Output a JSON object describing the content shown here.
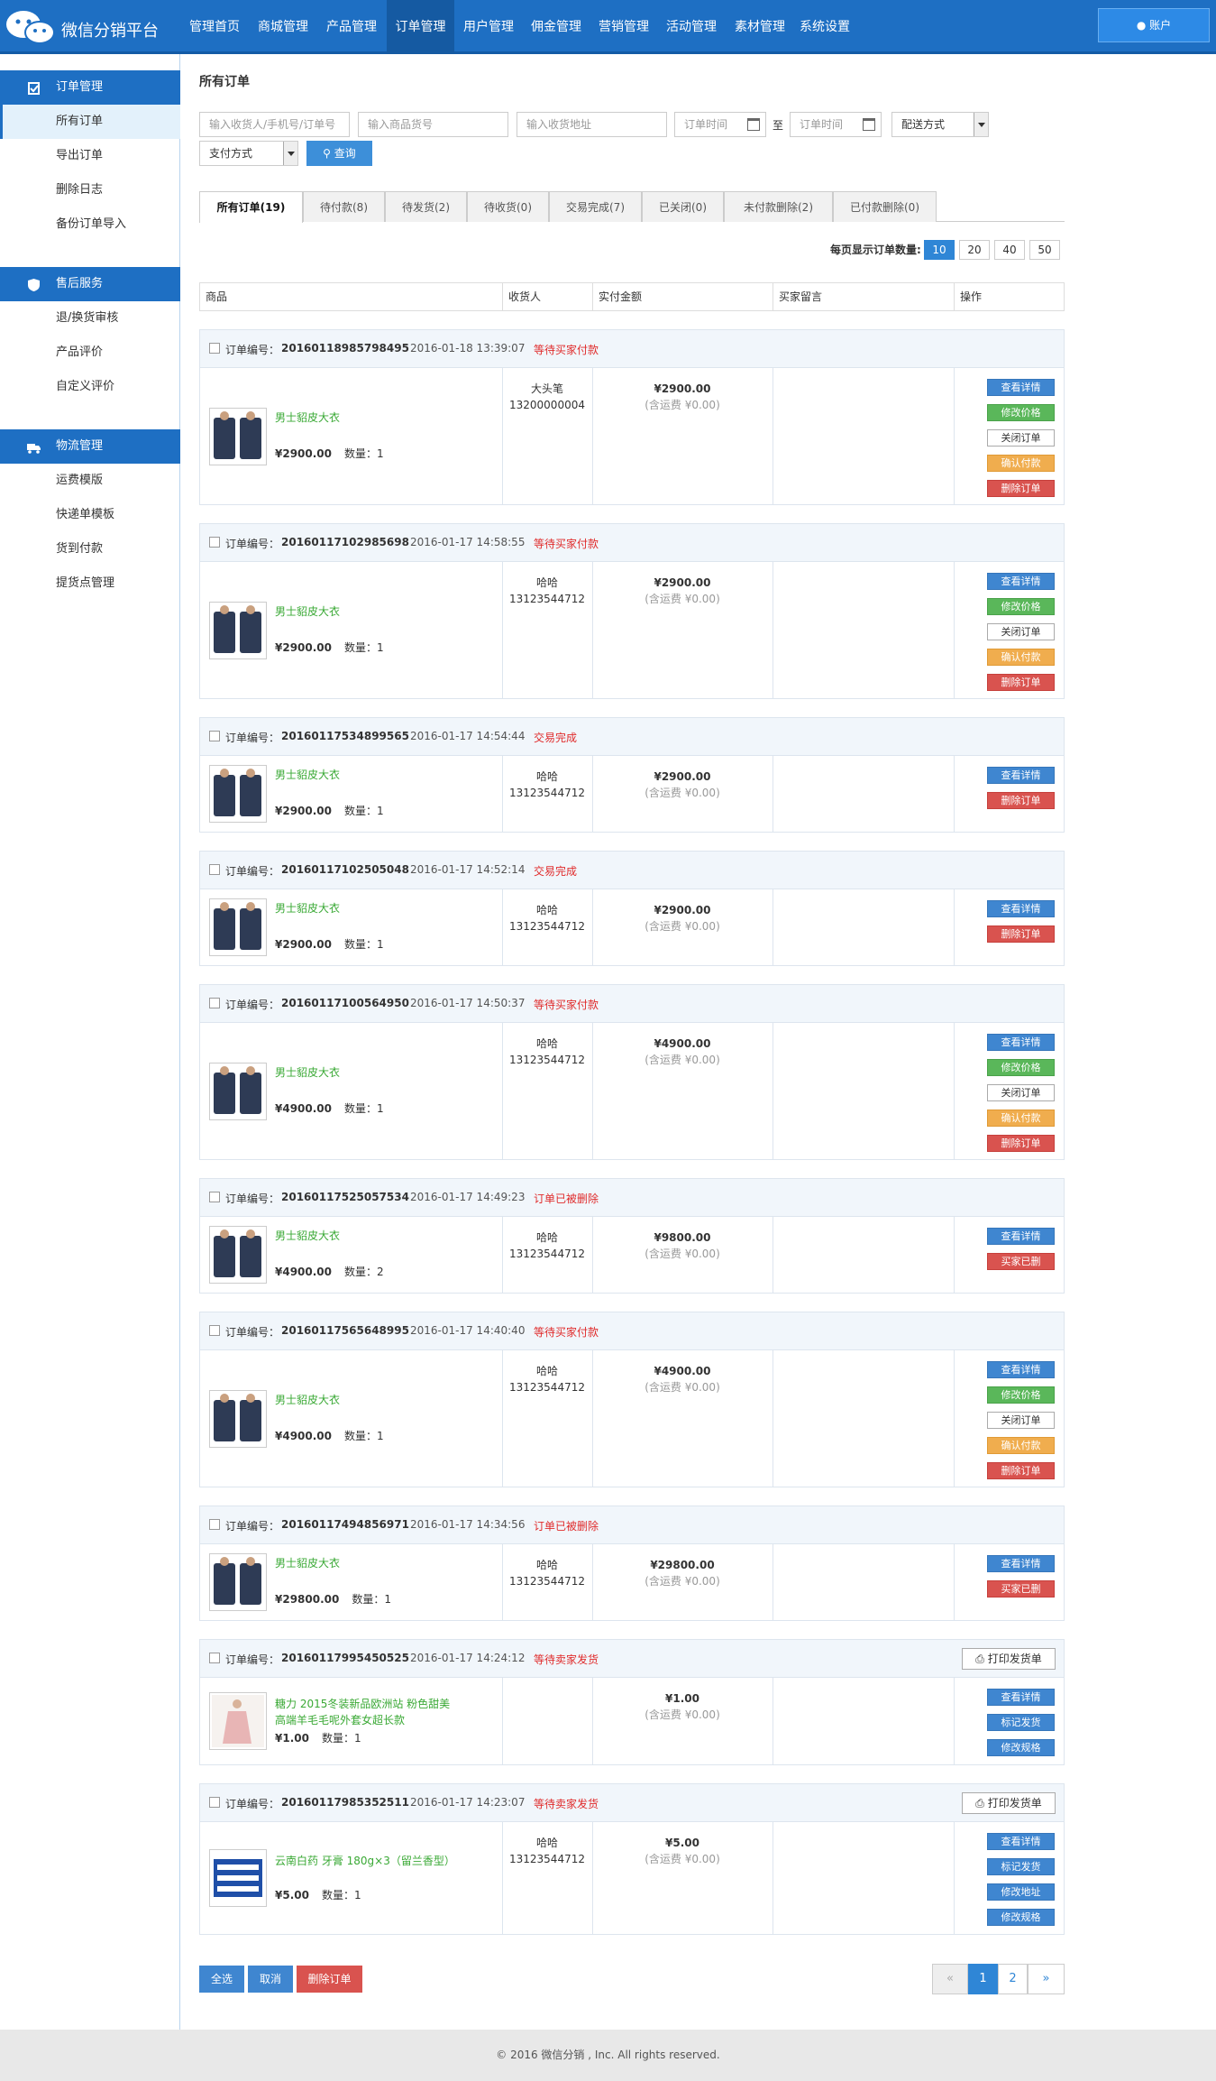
{
  "app": {
    "title": "微信分销平台",
    "account_label": "账户"
  },
  "nav": [
    {
      "label": "管理首页"
    },
    {
      "label": "商城管理"
    },
    {
      "label": "产品管理"
    },
    {
      "label": "订单管理",
      "active": true
    },
    {
      "label": "用户管理"
    },
    {
      "label": "佣金管理"
    },
    {
      "label": "营销管理"
    },
    {
      "label": "活动管理"
    },
    {
      "label": "素材管理"
    },
    {
      "label": "系统设置"
    }
  ],
  "sidebar": [
    {
      "title": "订单管理",
      "icon": "clipboard-icon",
      "items": [
        "所有订单",
        "导出订单",
        "删除日志",
        "备份订单导入"
      ]
    },
    {
      "title": "售后服务",
      "icon": "shield-icon",
      "items": [
        "退/换货审核",
        "产品评价",
        "自定义评价"
      ]
    },
    {
      "title": "物流管理",
      "icon": "truck-icon",
      "items": [
        "运费模版",
        "快递单模板",
        "货到付款",
        "提货点管理"
      ]
    }
  ],
  "page_title": "所有订单",
  "filters": {
    "receiver_placeholder": "输入收货人/手机号/订单号",
    "goods_placeholder": "输入商品货号",
    "address_placeholder": "输入收货地址",
    "time_from_placeholder": "订单时间",
    "to_label": "至",
    "time_to_placeholder": "订单时间",
    "shipping_select": "配送方式",
    "payment_select": "支付方式",
    "search_label": "查询"
  },
  "tabs": [
    "所有订单(19)",
    "待付款(8)",
    "待发货(2)",
    "待收货(0)",
    "交易完成(7)",
    "已关闭(0)",
    "未付款删除(2)",
    "已付款删除(0)"
  ],
  "per_page": {
    "label": "每页显示订单数量:",
    "options": [
      "10",
      "20",
      "40",
      "50"
    ],
    "selected": "10"
  },
  "columns": [
    "商品",
    "收货人",
    "实付金额",
    "买家留言",
    "操作"
  ],
  "order_label": "订单编号：",
  "orders": [
    {
      "no": "20160118985798495",
      "time": "2016-01-18 13:39:07",
      "status": "等待买家付款",
      "product": "男士貂皮大衣",
      "price": "¥2900.00",
      "qty": "数量：1",
      "receiver": "大头笔",
      "phone": "13200000004",
      "amount": "¥2900.00",
      "freight": "(含运费 ¥0.00)",
      "buttons": [
        {
          "label": "查看详情",
          "style": "blue"
        },
        {
          "label": "修改价格",
          "style": "green"
        },
        {
          "label": "关闭订单",
          "style": "white"
        },
        {
          "label": "确认付款",
          "style": "orange"
        },
        {
          "label": "删除订单",
          "style": "red"
        }
      ]
    },
    {
      "no": "20160117102985698",
      "time": "2016-01-17 14:58:55",
      "status": "等待买家付款",
      "product": "男士貂皮大衣",
      "price": "¥2900.00",
      "qty": "数量：1",
      "receiver": "哈哈",
      "phone": "13123544712",
      "amount": "¥2900.00",
      "freight": "(含运费 ¥0.00)",
      "buttons": [
        {
          "label": "查看详情",
          "style": "blue"
        },
        {
          "label": "修改价格",
          "style": "green"
        },
        {
          "label": "关闭订单",
          "style": "white"
        },
        {
          "label": "确认付款",
          "style": "orange"
        },
        {
          "label": "删除订单",
          "style": "red"
        }
      ]
    },
    {
      "no": "20160117534899565",
      "time": "2016-01-17 14:54:44",
      "status": "交易完成",
      "product": "男士貂皮大衣",
      "price": "¥2900.00",
      "qty": "数量：1",
      "receiver": "哈哈",
      "phone": "13123544712",
      "amount": "¥2900.00",
      "freight": "(含运费 ¥0.00)",
      "buttons": [
        {
          "label": "查看详情",
          "style": "blue"
        },
        {
          "label": "删除订单",
          "style": "red"
        }
      ]
    },
    {
      "no": "20160117102505048",
      "time": "2016-01-17 14:52:14",
      "status": "交易完成",
      "product": "男士貂皮大衣",
      "price": "¥2900.00",
      "qty": "数量：1",
      "receiver": "哈哈",
      "phone": "13123544712",
      "amount": "¥2900.00",
      "freight": "(含运费 ¥0.00)",
      "buttons": [
        {
          "label": "查看详情",
          "style": "blue"
        },
        {
          "label": "删除订单",
          "style": "red"
        }
      ]
    },
    {
      "no": "20160117100564950",
      "time": "2016-01-17 14:50:37",
      "status": "等待买家付款",
      "product": "男士貂皮大衣",
      "price": "¥4900.00",
      "qty": "数量：1",
      "receiver": "哈哈",
      "phone": "13123544712",
      "amount": "¥4900.00",
      "freight": "(含运费 ¥0.00)",
      "buttons": [
        {
          "label": "查看详情",
          "style": "blue"
        },
        {
          "label": "修改价格",
          "style": "green"
        },
        {
          "label": "关闭订单",
          "style": "white"
        },
        {
          "label": "确认付款",
          "style": "orange"
        },
        {
          "label": "删除订单",
          "style": "red"
        }
      ]
    },
    {
      "no": "20160117525057534",
      "time": "2016-01-17 14:49:23",
      "status": "订单已被删除",
      "product": "男士貂皮大衣",
      "price": "¥4900.00",
      "qty": "数量：2",
      "receiver": "哈哈",
      "phone": "13123544712",
      "amount": "¥9800.00",
      "freight": "(含运费 ¥0.00)",
      "buttons": [
        {
          "label": "查看详情",
          "style": "blue"
        },
        {
          "label": "买家已删",
          "style": "red"
        }
      ]
    },
    {
      "no": "20160117565648995",
      "time": "2016-01-17 14:40:40",
      "status": "等待买家付款",
      "product": "男士貂皮大衣",
      "price": "¥4900.00",
      "qty": "数量：1",
      "receiver": "哈哈",
      "phone": "13123544712",
      "amount": "¥4900.00",
      "freight": "(含运费 ¥0.00)",
      "buttons": [
        {
          "label": "查看详情",
          "style": "blue"
        },
        {
          "label": "修改价格",
          "style": "green"
        },
        {
          "label": "关闭订单",
          "style": "white"
        },
        {
          "label": "确认付款",
          "style": "orange"
        },
        {
          "label": "删除订单",
          "style": "red"
        }
      ]
    },
    {
      "no": "20160117494856971",
      "time": "2016-01-17 14:34:56",
      "status": "订单已被删除",
      "product": "男士貂皮大衣",
      "price": "¥29800.00",
      "qty": "数量：1",
      "receiver": "哈哈",
      "phone": "13123544712",
      "amount": "¥29800.00",
      "freight": "(含运费 ¥0.00)",
      "buttons": [
        {
          "label": "查看详情",
          "style": "blue"
        },
        {
          "label": "买家已删",
          "style": "red"
        }
      ]
    },
    {
      "no": "20160117995450525",
      "time": "2016-01-17 14:24:12",
      "status": "等待卖家发货",
      "print_label": "打印发货单",
      "product": "糖力 2015冬装新品欧洲站 粉色甜美高端羊毛毛呢外套女超长款",
      "price": "¥1.00",
      "qty": "数量：1",
      "receiver": "",
      "phone": "",
      "amount": "¥1.00",
      "freight": "(含运费 ¥0.00)",
      "buttons": [
        {
          "label": "查看详情",
          "style": "blue"
        },
        {
          "label": "标记发货",
          "style": "blue"
        },
        {
          "label": "修改规格",
          "style": "blue"
        }
      ]
    },
    {
      "no": "20160117985352511",
      "time": "2016-01-17 14:23:07",
      "status": "等待卖家发货",
      "print_label": "打印发货单",
      "product": "云南白药 牙膏 180g×3（留兰香型）",
      "price": "¥5.00",
      "qty": "数量：1",
      "receiver": "哈哈",
      "phone": "13123544712",
      "amount": "¥5.00",
      "freight": "(含运费 ¥0.00)",
      "buttons": [
        {
          "label": "查看详情",
          "style": "blue"
        },
        {
          "label": "标记发货",
          "style": "blue"
        },
        {
          "label": "修改地址",
          "style": "blue"
        },
        {
          "label": "修改规格",
          "style": "blue"
        }
      ]
    }
  ],
  "bulk": {
    "select_all": "全选",
    "cancel": "取消",
    "delete": "删除订单"
  },
  "pager": {
    "prev": "«",
    "pages": [
      "1",
      "2"
    ],
    "current": "1",
    "next": "»"
  },
  "footer": "© 2016 微信分销 , Inc. All rights reserved."
}
